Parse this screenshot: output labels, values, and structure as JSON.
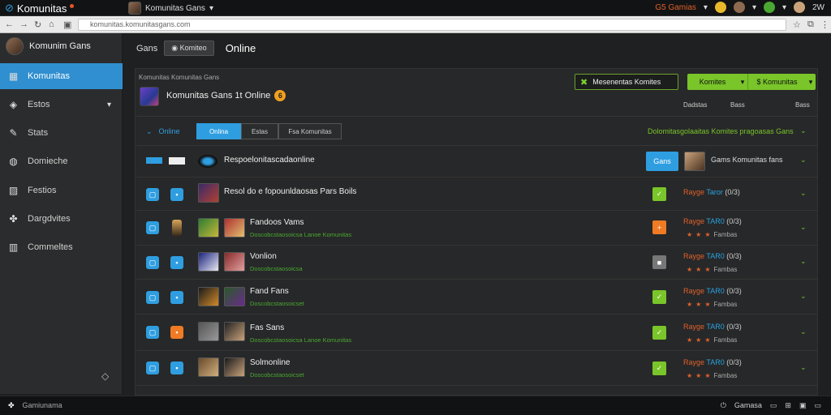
{
  "topbar": {
    "app_name": "Komunitas",
    "user_name": "Komunitas Gans",
    "notif_text": "G5 Gamias",
    "right_label": "2W"
  },
  "urlbar": {
    "url": "komunitas.komunitasgans.com"
  },
  "sidebar": {
    "profile_name": "Komunim Gans",
    "items": [
      {
        "label": "Komunitas",
        "icon": "gamepad-icon"
      },
      {
        "label": "Estos",
        "icon": "controller-icon"
      },
      {
        "label": "Stats",
        "icon": "wrench-icon"
      },
      {
        "label": "Domieche",
        "icon": "globe-icon"
      },
      {
        "label": "Festios",
        "icon": "image-icon"
      },
      {
        "label": "Dargdvites",
        "icon": "puzzle-icon"
      },
      {
        "label": "Commeltes",
        "icon": "grid-icon"
      }
    ]
  },
  "main": {
    "tab_label": "Gans",
    "select_value": "Komiteo",
    "online_label": "Online",
    "breadcrumb": "Komunitas Komunitas Gans",
    "game_title": "Komunitas Gans 1t Online",
    "badge": "6",
    "msg_button": "Mesenentas Komites",
    "green_btn_1": "Komites",
    "green_btn_2": "Komunitas",
    "hdr_col_1": "Dadstas",
    "hdr_col_2": "Bass",
    "hdr_col_3": "Bass"
  },
  "filters": {
    "online_label": "Online",
    "tabs": [
      "Onlina",
      "Estas",
      "Fsa Komunitas"
    ],
    "right_label": "Dolomitasgolaaitas Komites pragoasas Gans"
  },
  "rows": [
    {
      "title": "Respoelonitascadaonline",
      "subtitle": "",
      "status_color": "#2f9ee0",
      "status_icon": "Gans",
      "tag": "Gams Komunitas fans",
      "rating": ""
    },
    {
      "title": "Resol do e fopounldaosas Pars Boils",
      "subtitle": "",
      "status_color": "#79c52a",
      "status_icon": "✓",
      "tag_a": "Rayge",
      "tag_b": "Taror",
      "tag_c": "(0/3)",
      "rating": ""
    },
    {
      "title": "Fandoos Vams",
      "subtitle": "Doscobcstaosoicsa Lanoe Komunitas",
      "status_color": "#f07b24",
      "status_icon": "+",
      "tag_a": "Rayge",
      "tag_b": "TAR0",
      "tag_c": "(0/3)",
      "rating": "Fambas"
    },
    {
      "title": "Vonlion",
      "subtitle": "Doscobcstaosoicsa",
      "status_color": "#777777",
      "status_icon": "■",
      "tag_a": "Rayge",
      "tag_b": "TAR0",
      "tag_c": "(0/3)",
      "rating": "Fambas"
    },
    {
      "title": "Fand Fans",
      "subtitle": "Doscobcstaosoicset",
      "status_color": "#79c52a",
      "status_icon": "✓",
      "tag_a": "Rayge",
      "tag_b": "TAR0",
      "tag_c": "(0/3)",
      "rating": "Fambas"
    },
    {
      "title": "Fas Sans",
      "subtitle": "Doscobcstaosoicsa Lanoe Komunitas",
      "status_color": "#79c52a",
      "status_icon": "✓",
      "tag_a": "Rayge",
      "tag_b": "TAR0",
      "tag_c": "(0/3)",
      "rating": "Fambas"
    },
    {
      "title": "Solmonline",
      "subtitle": "Doscobcstaosoicset",
      "status_color": "#79c52a",
      "status_icon": "✓",
      "tag_a": "Rayge",
      "tag_b": "TAR0",
      "tag_c": "(0/3)",
      "rating": "Fambas"
    }
  ],
  "footer": {
    "left_label": "Gamiunama",
    "right_label": "Gamasa"
  }
}
